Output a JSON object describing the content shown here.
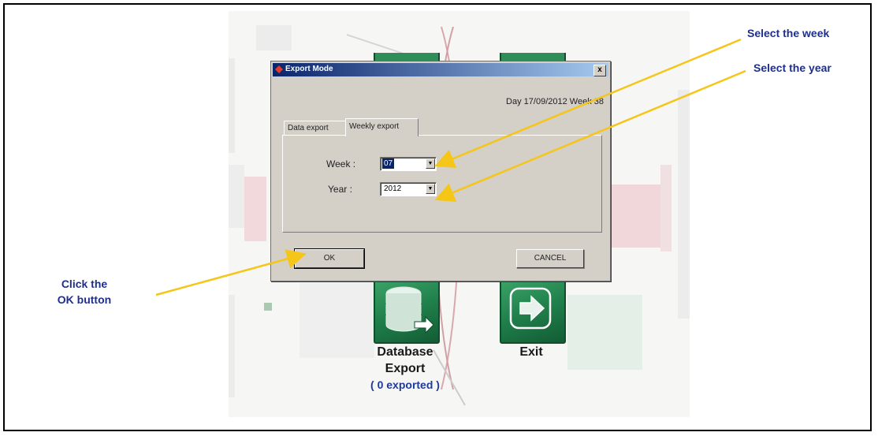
{
  "callouts": {
    "select_week": "Select the week",
    "select_year": "Select the year",
    "click_ok_line1": "Click the",
    "click_ok_line2": "OK button"
  },
  "dialog": {
    "title": "Export Mode",
    "close_label": "x",
    "day_info": "Day 17/09/2012  Week 38",
    "tabs": [
      {
        "label": "Data export",
        "active": false
      },
      {
        "label": "Weekly export",
        "active": true
      }
    ],
    "week": {
      "label": "Week :",
      "value": "07"
    },
    "year": {
      "label": "Year :",
      "value": "2012"
    },
    "ok_label": "OK",
    "cancel_label": "CANCEL"
  },
  "tiles": {
    "database_export": {
      "line1": "Database",
      "line2": "Export",
      "status": "( 0 exported )"
    },
    "exit": {
      "label": "Exit"
    }
  },
  "colors": {
    "callout_text": "#1e2f8c",
    "arrow": "#f5c518",
    "tile_green": "#1f7e4a",
    "dialog_bg": "#d4d0c8",
    "title_bar": "#0a246a"
  },
  "icons": [
    "database-export-icon",
    "exit-arrow-icon",
    "close-icon",
    "dropdown-arrow-icon"
  ]
}
